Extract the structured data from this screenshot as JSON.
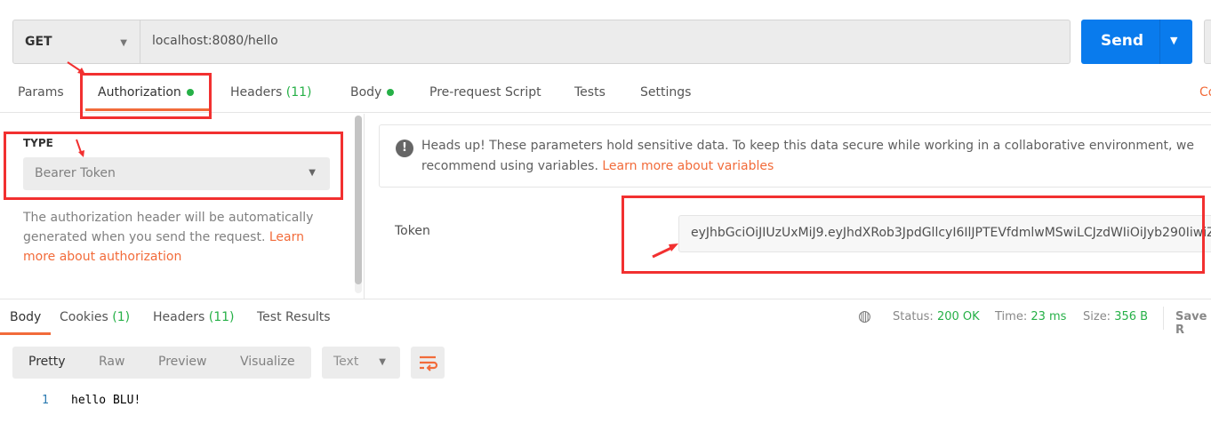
{
  "request": {
    "method": "GET",
    "url": "localhost:8080/hello",
    "send_label": "Send"
  },
  "tabs": {
    "params": "Params",
    "authorization": "Authorization",
    "headers": "Headers",
    "headers_count": "(11)",
    "body": "Body",
    "prerequest": "Pre-request Script",
    "tests": "Tests",
    "settings": "Settings",
    "cookies_link": "Co"
  },
  "auth": {
    "type_label": "TYPE",
    "type_value": "Bearer Token",
    "help_text": "The authorization header will be automatically generated when you send the request. ",
    "help_link": "Learn more about authorization",
    "notice_text": "Heads up! These parameters hold sensitive data. To keep this data secure while working in a collaborative environment, we recommend using variables. ",
    "notice_link": "Learn more about variables",
    "token_label": "Token",
    "token_value": "eyJhbGciOiJIUzUxMiJ9.eyJhdXRob3JpdGllcyI6IlJPTEVfdmlwMSwiLCJzdWIiOiJyb290IiwiZ"
  },
  "response": {
    "tabs": {
      "body": "Body",
      "cookies": "Cookies",
      "cookies_count": "(1)",
      "headers": "Headers",
      "headers_count": "(11)",
      "test_results": "Test Results"
    },
    "status_label": "Status:",
    "status": "200 OK",
    "time_label": "Time:",
    "time": "23 ms",
    "size_label": "Size:",
    "size": "356 B",
    "save": "Save R",
    "modes": [
      "Pretty",
      "Raw",
      "Preview",
      "Visualize"
    ],
    "format": "Text",
    "line_number": "1",
    "content": "hello BLU!"
  },
  "colors": {
    "accent": "#f26b3a",
    "send": "#097bed",
    "success": "#26b047",
    "annotation": "#f23030"
  }
}
